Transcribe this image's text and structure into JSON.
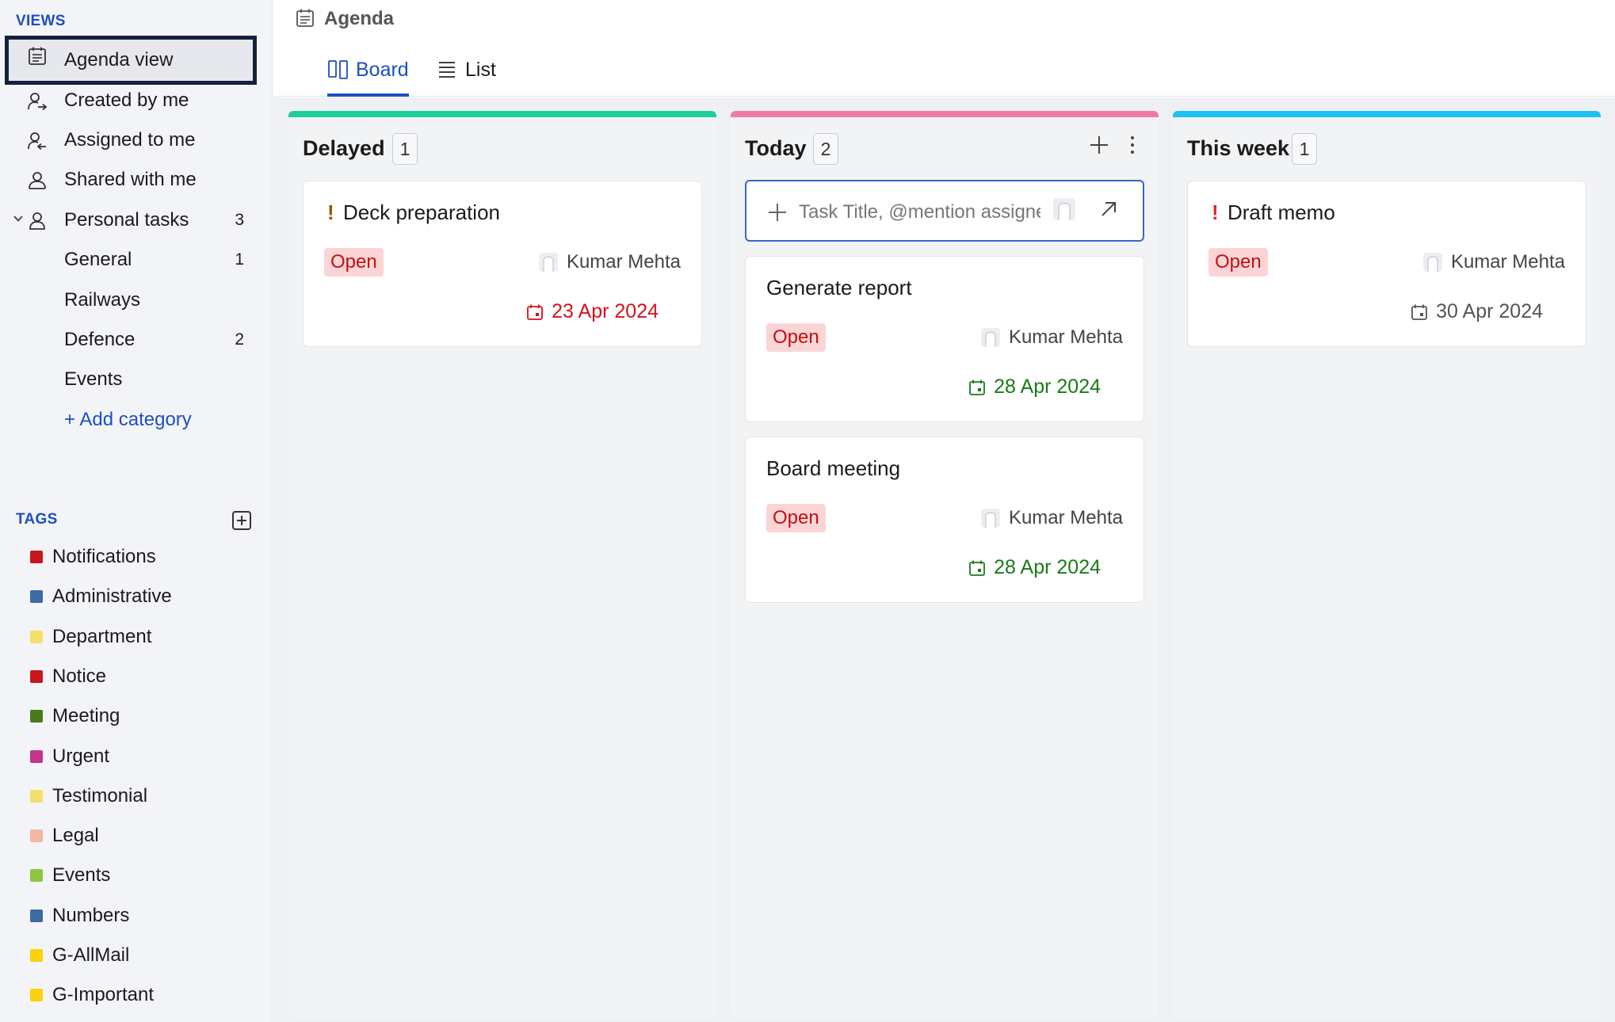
{
  "sidebar": {
    "views_title": "VIEWS",
    "views": [
      {
        "label": "Agenda view",
        "count": ""
      },
      {
        "label": "Created by me",
        "count": ""
      },
      {
        "label": "Assigned to me",
        "count": ""
      },
      {
        "label": "Shared with me",
        "count": ""
      },
      {
        "label": "Personal tasks",
        "count": "3"
      }
    ],
    "categories": [
      {
        "label": "General",
        "count": "1"
      },
      {
        "label": "Railways",
        "count": ""
      },
      {
        "label": "Defence",
        "count": "2"
      },
      {
        "label": "Events",
        "count": ""
      }
    ],
    "add_category": "+ Add category",
    "tags_title": "TAGS",
    "tags": [
      {
        "label": "Notifications",
        "color": "#c8161d"
      },
      {
        "label": "Administrative",
        "color": "#3c6aa3"
      },
      {
        "label": "Department",
        "color": "#f4e06a"
      },
      {
        "label": "Notice",
        "color": "#c8161d"
      },
      {
        "label": "Meeting",
        "color": "#4a7a1e"
      },
      {
        "label": "Urgent",
        "color": "#c8338a"
      },
      {
        "label": "Testimonial",
        "color": "#f4e06a"
      },
      {
        "label": "Legal",
        "color": "#f3b7a4"
      },
      {
        "label": "Events",
        "color": "#8cc63f"
      },
      {
        "label": "Numbers",
        "color": "#3c6aa3"
      },
      {
        "label": "G-AllMail",
        "color": "#fbd20c"
      },
      {
        "label": "G-Important",
        "color": "#fbd20c"
      }
    ]
  },
  "header": {
    "title": "Agenda",
    "tabs": [
      {
        "label": "Board",
        "active": true
      },
      {
        "label": "List",
        "active": false
      }
    ]
  },
  "board": {
    "columns": [
      {
        "title": "Delayed",
        "count": "1",
        "accent": "#1fcf9a",
        "cards": [
          {
            "title": "Deck preparation",
            "priority": "!",
            "priority_color": "#8a5a00",
            "status": "Open",
            "assignee": "Kumar Mehta",
            "due": "23 Apr 2024",
            "due_color": "#d4131b"
          }
        ]
      },
      {
        "title": "Today",
        "count": "2",
        "accent": "#f07aa7",
        "quick_add_placeholder": "Task Title, @mention assignee",
        "cards": [
          {
            "title": "Generate report",
            "priority": "",
            "status": "Open",
            "assignee": "Kumar Mehta",
            "due": "28 Apr 2024",
            "due_color": "#1a7b19"
          },
          {
            "title": "Board meeting",
            "priority": "",
            "status": "Open",
            "assignee": "Kumar Mehta",
            "due": "28 Apr 2024",
            "due_color": "#1a7b19"
          }
        ]
      },
      {
        "title": "This week",
        "count": "1",
        "accent": "#1cc3f2",
        "cards": [
          {
            "title": "Draft memo",
            "priority": "!",
            "priority_color": "#e0262f",
            "status": "Open",
            "assignee": "Kumar Mehta",
            "due": "30 Apr 2024",
            "due_color": "#555555"
          }
        ]
      }
    ]
  }
}
